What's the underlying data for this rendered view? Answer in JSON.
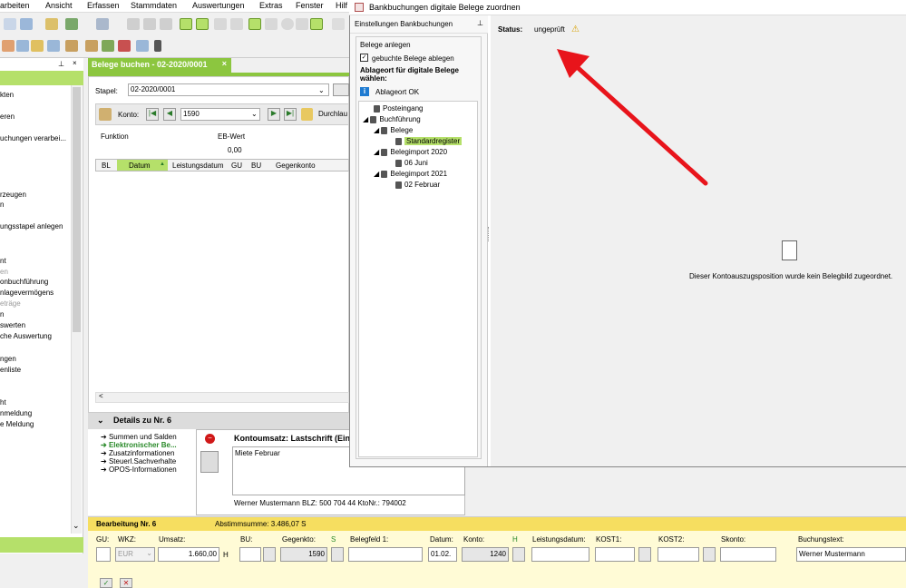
{
  "menu": [
    "arbeiten",
    "Ansicht",
    "Erfassen",
    "Stammdaten",
    "Auswertungen",
    "Extras",
    "Fenster",
    "Hilf"
  ],
  "left_items": [
    "kten",
    "eren",
    "uchungen verarbei...",
    "rzeugen",
    "n",
    "ungsstapel anlegen",
    "nt",
    "en",
    "onbuchführung",
    "nlagevermögens",
    "eträge",
    "n",
    "swerten",
    "che Auswertung",
    "ngen",
    "enliste",
    "ht",
    "nmeldung",
    "e Meldung"
  ],
  "tab": "Belege buchen - 02-2020/0001",
  "stapel": {
    "label": "Stapel:",
    "value": "02-2020/0001"
  },
  "konto": {
    "label": "Konto:",
    "value": "1590",
    "extra": "Durchlau"
  },
  "funktion": {
    "label": "Funktion",
    "eb_label": "EB-Wert",
    "eb_value": "0,00"
  },
  "grid_headers": [
    "BL",
    "Datum",
    "Leistungsdatum",
    "GU",
    "BU",
    "Gegenkonto"
  ],
  "details": {
    "title": "Details zu Nr. 6",
    "links": [
      "Summen und Salden",
      "Elektronischer Be...",
      "Zusatzinformationen",
      "Steuerl.Sachverhalte",
      "OPOS-Informationen"
    ],
    "kontoumsatz": "Kontoumsatz: Lastschrift (Ein:",
    "text": "Miete Februar",
    "footer": "Werner Mustermann   BLZ: 500 704 44   KtoNr.: 794002"
  },
  "bearbeitung": {
    "title": "Bearbeitung Nr. 6",
    "summe": "Abstimmsumme: 3.486,07 S",
    "labels": [
      "GU:",
      "WKZ:",
      "Umsatz:",
      "BU:",
      "Gegenkto:",
      "S",
      "Belegfeld 1:",
      "Datum:",
      "Konto:",
      "H",
      "Leistungsdatum:",
      "KOST1:",
      "KOST2:",
      "Skonto:",
      "Buchungstext:"
    ],
    "wkz": "EUR",
    "umsatz": "1.660,00",
    "h": "H",
    "gegenkto": "1590",
    "datum": "01.02.",
    "konto": "1240",
    "buchungstext": "Werner Mustermann"
  },
  "dialog": {
    "title": "Bankbuchungen digitale Belege zuordnen",
    "settings_title": "Einstellungen Bankbuchungen",
    "group": "Belege anlegen",
    "checkbox": "gebuchte Belege ablegen",
    "ablage_title": "Ablageort für digitale Belege wählen:",
    "ablage_ok": "Ablageort OK",
    "tree": [
      "Posteingang",
      "Buchführung",
      "Belege",
      "Standardregister",
      "Belegimport 2020",
      "06 Juni",
      "Belegimport 2021",
      "02 Februar"
    ],
    "status_label": "Status:",
    "status_value": "ungeprüft",
    "message": "Dieser Kontoauszugsposition wurde kein Belegbild zugeordnet."
  },
  "colors": {
    "green": "#8cc63f",
    "yellow": "#f6de60",
    "arrow": "#e8141b"
  }
}
